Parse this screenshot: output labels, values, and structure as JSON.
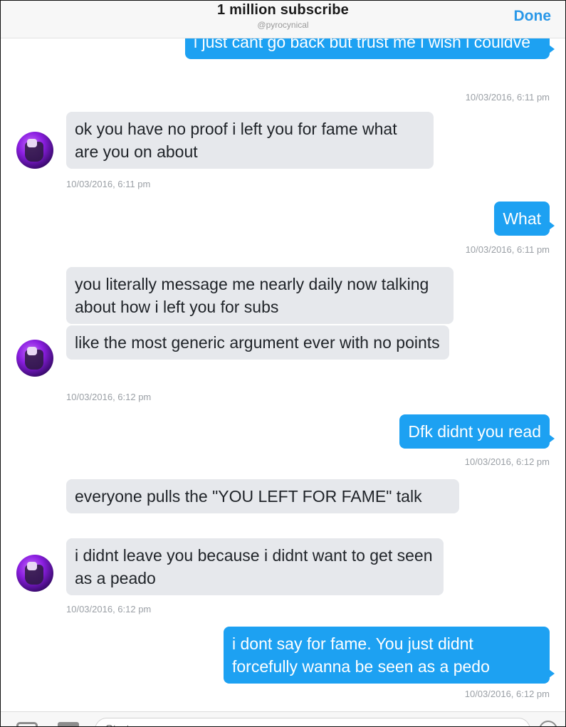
{
  "header": {
    "title": "1 million subscribe",
    "handle": "@pyrocynical",
    "done_label": "Done"
  },
  "messages": [
    {
      "dir": "out",
      "text": "i just cant go back but trust me i wish i couldve"
    },
    {
      "timestamp": "10/03/2016, 6:11 pm"
    },
    {
      "dir": "in",
      "text": "ok you have no proof i left you for fame what are you on about"
    },
    {
      "timestamp": "10/03/2016, 6:11 pm"
    },
    {
      "dir": "out",
      "text": "What"
    },
    {
      "timestamp": "10/03/2016, 6:11 pm"
    },
    {
      "dir": "in",
      "text": "you literally message me nearly daily now talking about how i left you for subs"
    },
    {
      "dir": "in",
      "text": "like the most generic argument ever with no points"
    },
    {
      "timestamp": "10/03/2016, 6:12 pm"
    },
    {
      "dir": "out",
      "text": "Dfk didnt you read"
    },
    {
      "timestamp": "10/03/2016, 6:12 pm"
    },
    {
      "dir": "in",
      "text": "everyone pulls the \"YOU LEFT FOR FAME\" talk"
    },
    {
      "dir": "in",
      "text": "i didnt leave you because i didnt want to get seen as a peado"
    },
    {
      "timestamp": "10/03/2016, 6:12 pm"
    },
    {
      "dir": "out",
      "text": "i dont say for fame. You just didnt forcefully wanna be seen as a pedo"
    },
    {
      "timestamp": "10/03/2016, 6:12 pm"
    }
  ],
  "composer": {
    "placeholder": "Start a message",
    "icons": [
      "camera-icon",
      "gif-icon",
      "emoji-icon"
    ]
  },
  "colors": {
    "outgoing_bubble": "#1da1f2",
    "incoming_bubble": "#e6e8ec",
    "done": "#2a98e8"
  }
}
